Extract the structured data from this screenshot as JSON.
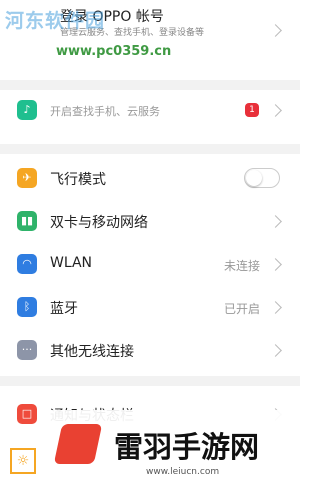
{
  "account": {
    "title": "登录 OPPO 帐号",
    "subtitle": "管理云服务、查找手机、登录设备等"
  },
  "find_phone": {
    "label": "开启查找手机、云服务",
    "badge": "1",
    "icon": "bell-icon",
    "color": "#1fbf8f"
  },
  "settings": [
    {
      "id": "airplane",
      "label": "飞行模式",
      "icon": "airplane-icon",
      "glyph": "✈",
      "color": "#f5a623",
      "status": "",
      "control": "toggle",
      "value": false
    },
    {
      "id": "dual-sim",
      "label": "双卡与移动网络",
      "icon": "signal-icon",
      "glyph": "▮",
      "color": "#2fb36a",
      "status": "",
      "control": "chevron"
    },
    {
      "id": "wlan",
      "label": "WLAN",
      "icon": "wifi-icon",
      "glyph": "◠",
      "color": "#2f7de1",
      "status": "未连接",
      "control": "chevron"
    },
    {
      "id": "bluetooth",
      "label": "蓝牙",
      "icon": "bluetooth-icon",
      "glyph": "ᛒ",
      "color": "#2f7de1",
      "status": "已开启",
      "control": "chevron"
    },
    {
      "id": "other-wireless",
      "label": "其他无线连接",
      "icon": "more-icon",
      "glyph": "···",
      "color": "#8d95a8",
      "status": "",
      "control": "chevron"
    },
    {
      "id": "notifications",
      "label": "通知与状态栏",
      "icon": "notification-icon",
      "glyph": "□",
      "color": "#ef4b3c",
      "status": "",
      "control": "chevron"
    }
  ],
  "watermarks": {
    "top_text": "河东软件园",
    "top_url": "www.pc0359.cn",
    "bottom_brand": "雷羽手游网",
    "bottom_url": "www.leiucn.com"
  }
}
